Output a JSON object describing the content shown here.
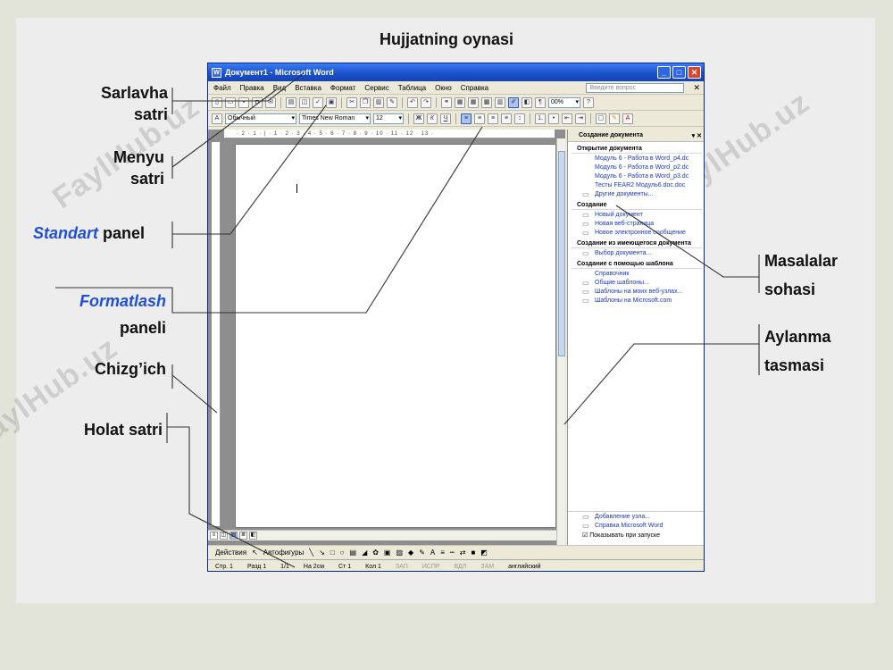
{
  "slide": {
    "title": "Hujjatning oynasi",
    "labels": {
      "sarlavha_1": "Sarlavha",
      "sarlavha_2": "satri",
      "menyu_1": "Menyu",
      "menyu_2": "satri",
      "standart_1": "Standart",
      "standart_2": "panel",
      "format_1": "Formatlash",
      "format_2": "paneli",
      "chizgich": "Chizg’ich",
      "holat": "Holat satri",
      "masalalar_1": "Masalalar",
      "masalalar_2": "sohasi",
      "aylanma_1": "Aylanma",
      "aylanma_2": "tasmasi"
    },
    "watermark": "FaylHub.uz",
    "colors": {
      "accent_label": "#1f4fd8",
      "background": "#ededee"
    }
  },
  "word": {
    "title": "Документ1 - Microsoft Word",
    "menu": [
      "Файл",
      "Правка",
      "Вид",
      "Вставка",
      "Формат",
      "Сервис",
      "Таблица",
      "Окно",
      "Справка"
    ],
    "help_placeholder": "Введите вопрос",
    "zoom": "00%",
    "style": "Обычный",
    "font": "Times New Roman",
    "size": "12",
    "ruler_text": "· 2 · 1 · | · 1 · 2 · 3 · 4 · 5 · 6 · 7 · 8 · 9 · 10 · 11 · 12 · 13 ·",
    "taskpane": {
      "title": "Создание документа",
      "open_header": "Открытие документа",
      "open_items": [
        "Модуль 6 - Работа в Word_p4.dc",
        "Модуль 6 - Работа в Word_p2.dc",
        "Модуль 6 - Работа в Word_p3.dc",
        "Тесты FEAR2 Модуль6.doc.doc"
      ],
      "other_docs": "Другие документы...",
      "create_header": "Создание",
      "create_items": [
        "Новый документ",
        "Новая веб-страница",
        "Новое электронное сообщение"
      ],
      "existing_header": "Создание из имеющегося документа",
      "existing_item": "Выбор документа...",
      "template_header": "Создание с помощью шаблона",
      "template_items": [
        "Справочник",
        "Общие шаблоны...",
        "Шаблоны на моих веб-узлах...",
        "Шаблоны на Microsoft.com"
      ],
      "bottom_items": [
        "Добавление узла...",
        "Справка Microsoft Word"
      ],
      "startup": "Показывать при запуске"
    },
    "draw": {
      "actions": "Действия",
      "autoshapes": "Автофигуры"
    },
    "status": [
      "Стр. 1",
      "Разд 1",
      "1/1",
      "На 2см",
      "Ст 1",
      "Кол 1"
    ],
    "status_dim": [
      "ЗАП",
      "ИСПР",
      "ВДЛ",
      "ЗАМ"
    ],
    "language": "английский"
  }
}
